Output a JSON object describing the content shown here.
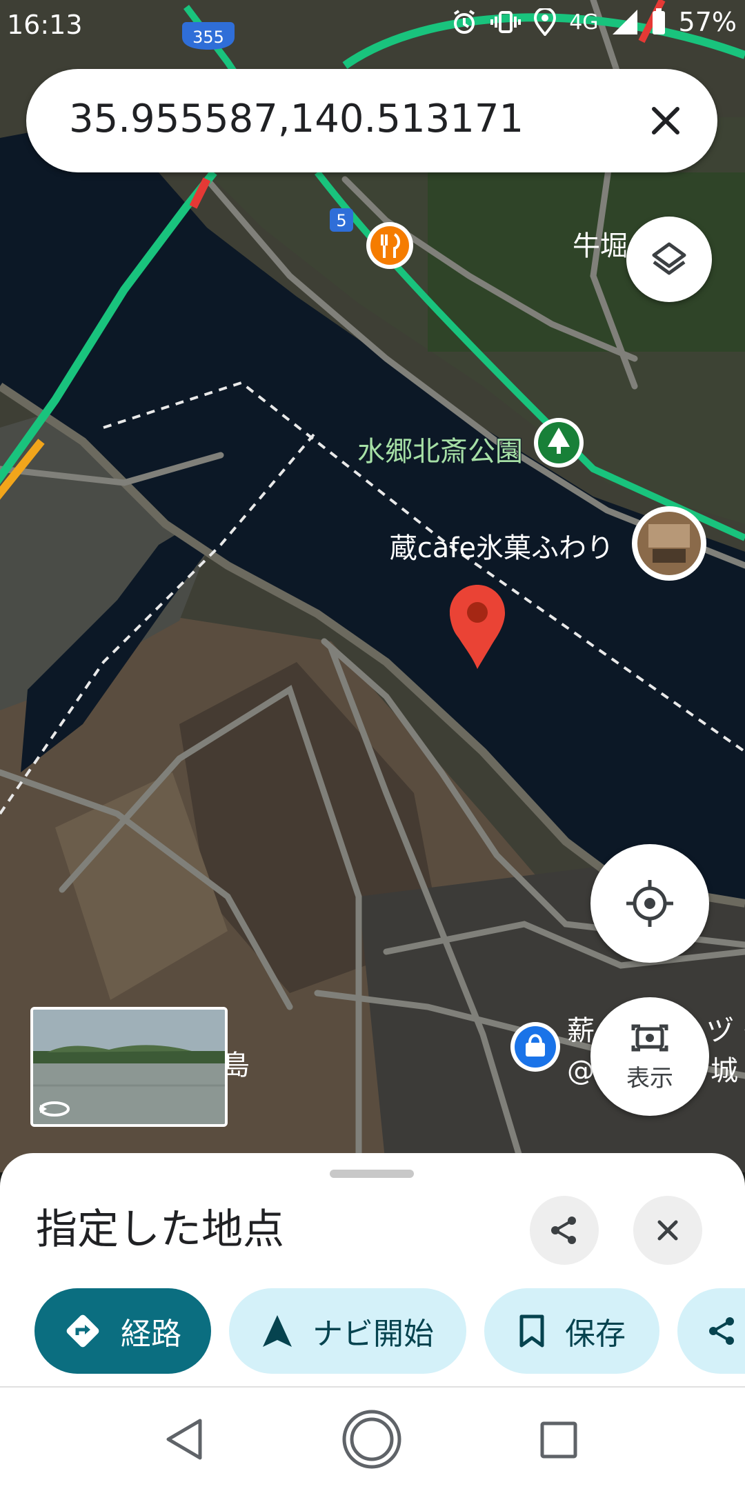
{
  "status_bar": {
    "time": "16:13",
    "battery": "57%",
    "network": "4G",
    "icons": [
      "alarm-icon",
      "vibrate-icon",
      "location-icon",
      "signal-icon",
      "battery-icon"
    ]
  },
  "search": {
    "query": "35.955587,140.513171",
    "clear_icon": "close-icon"
  },
  "map": {
    "view": "satellite",
    "labels": {
      "route_355": "355",
      "route_5": "5",
      "area_ushibori": "牛堀",
      "park": "水郷北斎公園",
      "cafe": "蔵cafe氷菓ふわり",
      "shima": "島",
      "shop_left": "薪",
      "shop_right_1": "ヅ・",
      "shop_right_2": "@",
      "shop_right_3": "城"
    },
    "colors": {
      "water": "#0c1826",
      "field": "#4f4a3f",
      "road": "#7c7c76",
      "traffic_green": "#19c37d",
      "traffic_orange": "#f2a51b",
      "traffic_red": "#e53935",
      "pin": "#ea4335",
      "restaurant": "#f57c00",
      "park_green": "#188038",
      "shop_blue": "#1a73e8"
    }
  },
  "buttons": {
    "layers_icon": "layers-icon",
    "my_location_icon": "my-location-icon",
    "lens_label": "表示",
    "lens_icon": "camera-lens-icon",
    "street_view_icon": "street-view-rotate-icon"
  },
  "sheet": {
    "title": "指定した地点",
    "share_icon": "share-icon",
    "close_icon": "close-icon",
    "chips": [
      {
        "label": "経路",
        "icon": "directions-icon"
      },
      {
        "label": "ナビ開始",
        "icon": "navigation-arrow-icon"
      },
      {
        "label": "保存",
        "icon": "bookmark-icon"
      },
      {
        "label": "",
        "icon": "share-icon"
      }
    ],
    "colors": {
      "primary": "#0b6e80",
      "chip_bg": "#d4f1f9",
      "chip_text": "#06434f"
    }
  },
  "navbar": {
    "icons": [
      "back-icon",
      "home-icon",
      "recents-icon"
    ]
  }
}
